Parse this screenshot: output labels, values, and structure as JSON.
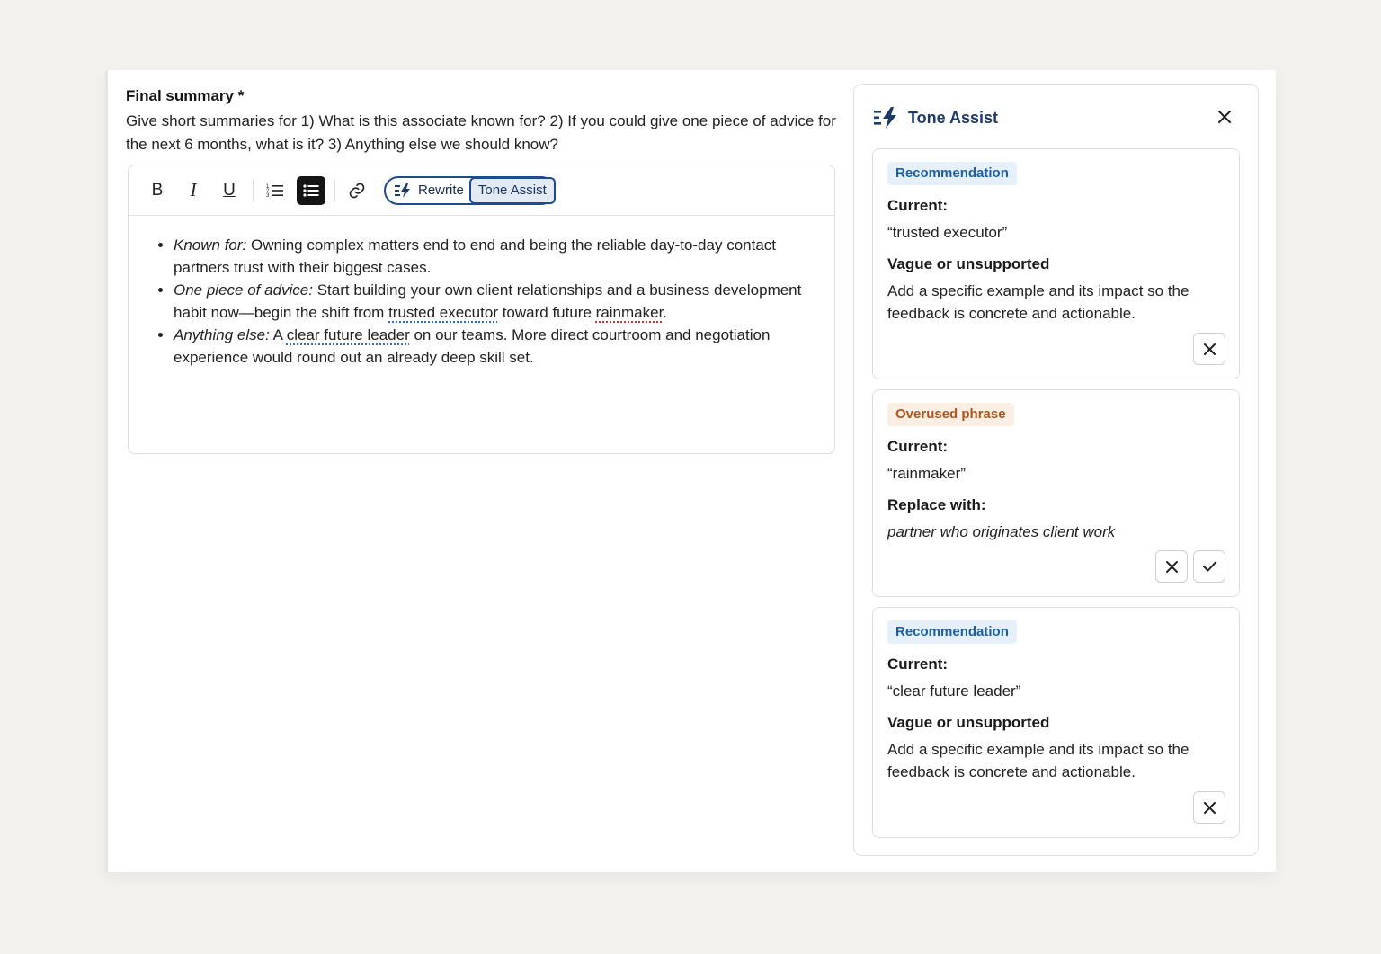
{
  "field": {
    "title": "Final summary *",
    "description": "Give short summaries for 1) What is this associate known for? 2) If you could give one piece of advice for the next 6 months, what is it? 3) Anything else we should know?"
  },
  "toolbar": {
    "bold": "B",
    "italic": "I",
    "underline": "U",
    "rewrite_label": "Rewrite",
    "tone_assist_label": "Tone Assist"
  },
  "editor": {
    "item1": {
      "label": "Known for:",
      "text": " Owning complex matters end to end and being the reliable day-to-day contact partners trust with their biggest cases."
    },
    "item2": {
      "label": "One piece of advice:",
      "text_a": " Start building your own client relationships and a business development habit now—begin the shift from ",
      "flag1": "trusted executor",
      "text_b": " toward future ",
      "flag2": "rainmaker",
      "text_c": "."
    },
    "item3": {
      "label": "Anything else:",
      "text_a": " A ",
      "flag": "clear future leader",
      "text_b": " on our teams. More direct courtroom and negotiation experience would round out an already deep skill set."
    }
  },
  "panel": {
    "title": "Tone Assist",
    "suggestions": [
      {
        "badge": "Recommendation",
        "current_label": "Current:",
        "current": "“trusted executor”",
        "issue_label": "Vague or unsupported",
        "issue_text": "Add a specific example and its impact so the feedback is concrete and actionable."
      },
      {
        "badge": "Overused phrase",
        "current_label": "Current:",
        "current": "“rainmaker”",
        "issue_label": "Replace with:",
        "issue_text": "partner who originates client work"
      },
      {
        "badge": "Recommendation",
        "current_label": "Current:",
        "current": "“clear future leader”",
        "issue_label": "Vague or unsupported",
        "issue_text": "Add a specific example and its impact so the feedback is concrete and actionable."
      }
    ]
  },
  "colors": {
    "accent": "#1e4b8f",
    "recommendation": "#1f5fa0",
    "overused": "#b0541c"
  }
}
